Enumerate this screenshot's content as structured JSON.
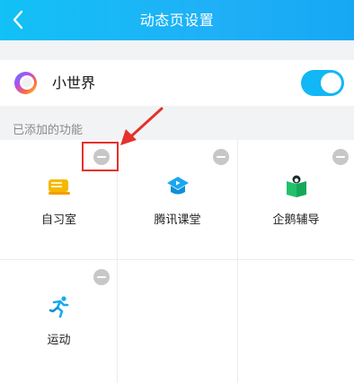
{
  "header": {
    "title": "动态页设置",
    "back_icon": "chevron-left-icon"
  },
  "world": {
    "label": "小世界",
    "enabled": true,
    "accent": "#12b7f5"
  },
  "section": {
    "label": "已添加的功能"
  },
  "items": [
    {
      "label": "自习室",
      "icon": "study-room-icon",
      "color": "#f5b800"
    },
    {
      "label": "腾讯课堂",
      "icon": "classroom-icon",
      "color": "#1aa7f0"
    },
    {
      "label": "企鹅辅导",
      "icon": "tutoring-icon",
      "color": "#22c06a"
    },
    {
      "label": "运动",
      "icon": "running-icon",
      "color": "#18a9f0"
    }
  ],
  "annotation": {
    "highlight_color": "#e4312b"
  }
}
